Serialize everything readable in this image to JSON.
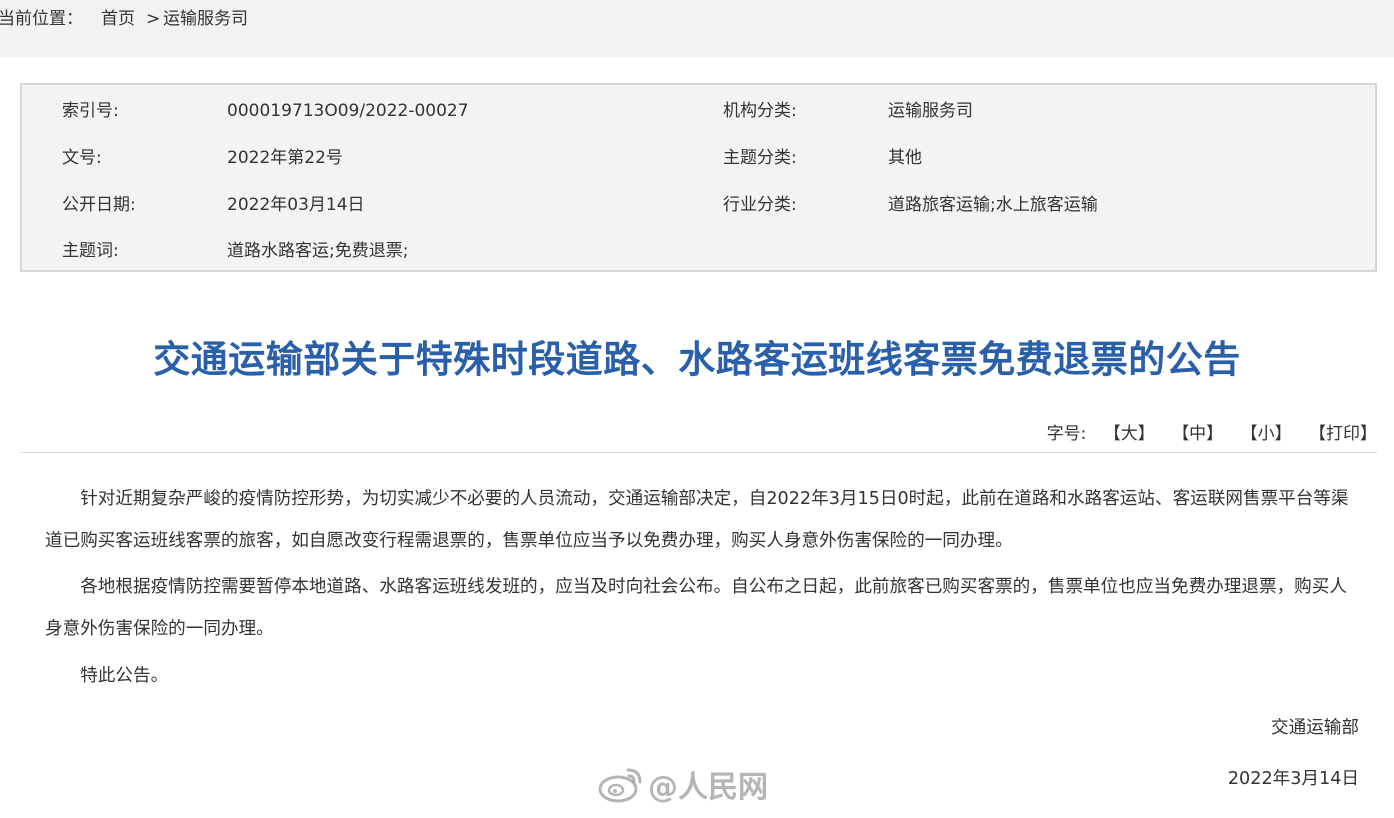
{
  "breadcrumb": {
    "prefix": "当前位置：",
    "home": "首页",
    "separator": ">",
    "current": "运输服务司"
  },
  "meta": {
    "index_label": "索引号:",
    "index_value": "000019713O09/2022-00027",
    "org_label": "机构分类:",
    "org_value": "运输服务司",
    "docno_label": "文号:",
    "docno_value": "2022年第22号",
    "topic_label": "主题分类:",
    "topic_value": "其他",
    "date_label": "公开日期:",
    "date_value": "2022年03月14日",
    "industry_label": "行业分类:",
    "industry_value": "道路旅客运输;水上旅客运输",
    "keywords_label": "主题词:",
    "keywords_value": "道路水路客运;免费退票;"
  },
  "title": "交通运输部关于特殊时段道路、水路客运班线客票免费退票的公告",
  "font_tools": {
    "label": "字号:",
    "large": "【大】",
    "medium": "【中】",
    "small": "【小】",
    "print": "【打印】"
  },
  "body": {
    "para1": "针对近期复杂严峻的疫情防控形势，为切实减少不必要的人员流动，交通运输部决定，自2022年3月15日0时起，此前在道路和水路客运站、客运联网售票平台等渠道已购买客运班线客票的旅客，如自愿改变行程需退票的，售票单位应当予以免费办理，购买人身意外伤害保险的一同办理。",
    "para2": "各地根据疫情防控需要暂停本地道路、水路客运班线发班的，应当及时向社会公布。自公布之日起，此前旅客已购买客票的，售票单位也应当免费办理退票，购买人身意外伤害保险的一同办理。",
    "para3": "特此公告。"
  },
  "signature": "交通运输部",
  "sign_date": "2022年3月14日",
  "watermark": {
    "text": "@人民网",
    "icon": "weibo-icon"
  },
  "colors": {
    "title": "#2a5faa",
    "breadcrumb_bg": "#f2f2f2",
    "meta_bg": "#f3f3f3",
    "meta_border": "#d6d6d6",
    "text": "#333333"
  }
}
